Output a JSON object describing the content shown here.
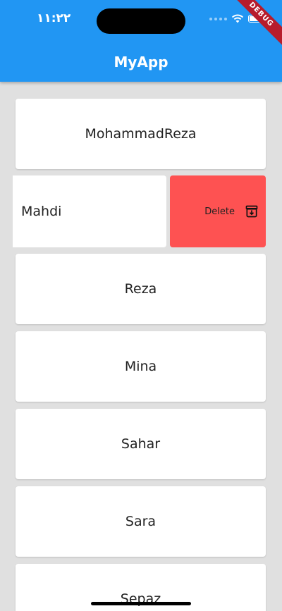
{
  "status_bar": {
    "time": "١١:٢٢"
  },
  "app_bar": {
    "title": "MyApp"
  },
  "debug_banner": "DEBUG",
  "list": {
    "items": [
      {
        "name": "MohammadReza"
      },
      {
        "name": "Mahdi",
        "action_label": "Delete"
      },
      {
        "name": "Reza"
      },
      {
        "name": "Mina"
      },
      {
        "name": "Sahar"
      },
      {
        "name": "Sara"
      },
      {
        "name": "Sepaz"
      }
    ]
  },
  "colors": {
    "app_bar": "#2196f3",
    "delete_action": "#fe5252",
    "background": "#e0e0e0"
  },
  "icons": {
    "delete": "archive-icon"
  }
}
